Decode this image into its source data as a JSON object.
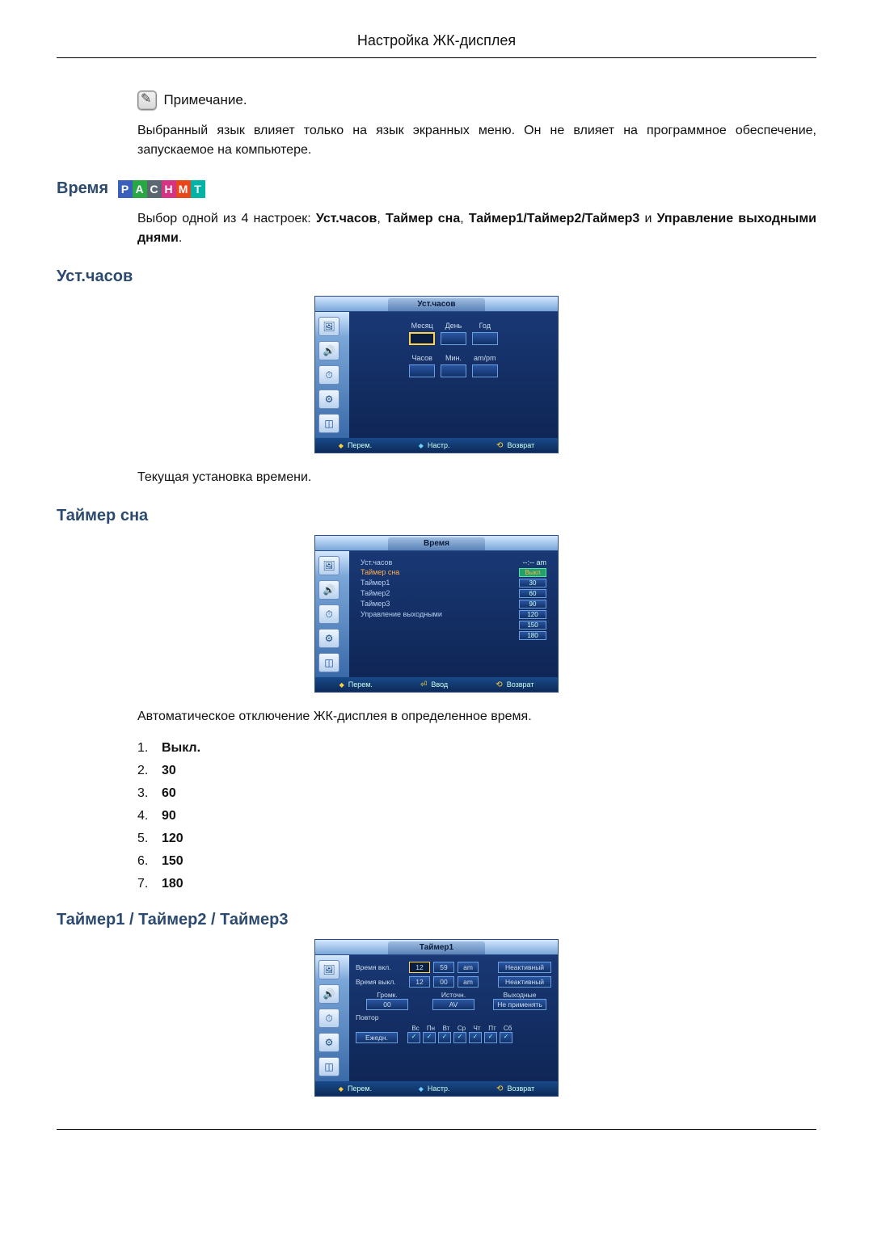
{
  "page_title": "Настройка ЖК-дисплея",
  "note": {
    "label": "Примечание.",
    "text": "Выбранный язык влияет только на язык экранных меню. Он не влияет на программное обеспечение, запускаемое на компьютере."
  },
  "time_section": {
    "heading": "Время",
    "badge": [
      "P",
      "A",
      "C",
      "H",
      "M",
      "T"
    ],
    "intro_pre": "Выбор одной из 4 настроек: ",
    "intro_b1": "Уст.часов",
    "intro_sep": ", ",
    "intro_b2": "Таймер сна",
    "intro_b3": "Таймер1/Таймер2/Таймер3",
    "intro_post": " и ",
    "intro_b4": "Управление выходными днями",
    "intro_end": "."
  },
  "clock_set": {
    "heading": "Уст.часов",
    "osd_title": "Уст.часов",
    "labels_top": [
      "Месяц",
      "День",
      "Год"
    ],
    "labels_bot": [
      "Часов",
      "Мин.",
      "am/pm"
    ],
    "footer": {
      "move": "Перем.",
      "adjust": "Настр.",
      "return": "Возврат"
    },
    "caption": "Текущая установка времени."
  },
  "sleep": {
    "heading": "Таймер сна",
    "osd_title": "Время",
    "rows": [
      {
        "k": "Уст.часов",
        "v": "--:-- am"
      },
      {
        "k": "Таймер сна",
        "v": ":"
      },
      {
        "k": "Таймер1",
        "v": ""
      },
      {
        "k": "Таймер2",
        "v": ""
      },
      {
        "k": "Таймер3",
        "v": ""
      },
      {
        "k": "Управление выходными",
        "v": ""
      }
    ],
    "options": [
      "Выкл",
      "30",
      "60",
      "90",
      "120",
      "150",
      "180"
    ],
    "footer": {
      "move": "Перем.",
      "enter": "Ввод",
      "return": "Возврат"
    },
    "caption": "Автоматическое отключение ЖК-дисплея в определенное время.",
    "list": [
      "Выкл.",
      "30",
      "60",
      "90",
      "120",
      "150",
      "180"
    ]
  },
  "timers": {
    "heading": "Таймер1 / Таймер2 / Таймер3",
    "osd_title": "Таймер1",
    "on": {
      "label": "Время вкл.",
      "h": "12",
      "m": "59",
      "ap": "am",
      "state": "Неактивный"
    },
    "off": {
      "label": "Время выкл.",
      "h": "12",
      "m": "00",
      "ap": "am",
      "state": "Неактивный"
    },
    "volume": {
      "label": "Громк.",
      "value": "00"
    },
    "source": {
      "label": "Источн.",
      "value": "AV"
    },
    "holiday": {
      "label": "Выходные",
      "value": "Не применять"
    },
    "repeat": {
      "label": "Повтор",
      "value": "Ежедн."
    },
    "days": [
      "Вс",
      "Пн",
      "Вт",
      "Ср",
      "Чт",
      "Пт",
      "Сб"
    ],
    "footer": {
      "move": "Перем.",
      "adjust": "Настр.",
      "return": "Возврат"
    }
  }
}
